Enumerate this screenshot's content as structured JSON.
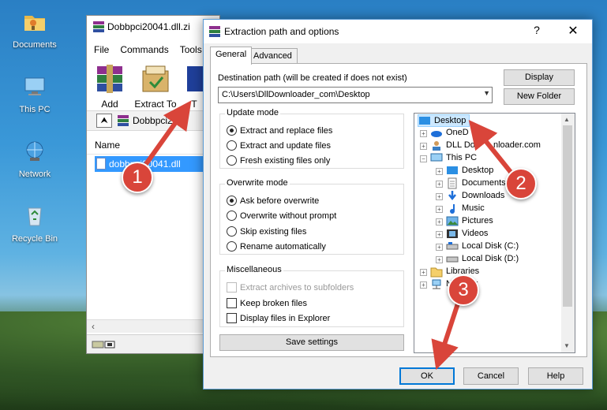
{
  "desktop": {
    "icons": [
      {
        "label": "Documents"
      },
      {
        "label": "This PC"
      },
      {
        "label": "Network"
      },
      {
        "label": "Recycle Bin"
      }
    ]
  },
  "winrar": {
    "title": "Dobbpci20041.dll.zi",
    "menu": [
      "File",
      "Commands",
      "Tools"
    ],
    "toolbar": {
      "add": "Add",
      "extract": "Extract To",
      "partial": "T"
    },
    "path": "Dobbpci20",
    "column_name": "Name",
    "selected_file": "dobbpci20041.dll"
  },
  "dialog": {
    "title": "Extraction path and options",
    "help": "?",
    "close": "✕",
    "tabs": [
      "General",
      "Advanced"
    ],
    "dest_label": "Destination path (will be created if does not exist)",
    "dest_value": "C:\\Users\\DllDownloader_com\\Desktop",
    "display_btn": "Display",
    "newfolder_btn": "New Folder",
    "update_mode": {
      "title": "Update mode",
      "options": [
        "Extract and replace files",
        "Extract and update files",
        "Fresh existing files only"
      ],
      "selected": 0
    },
    "overwrite_mode": {
      "title": "Overwrite mode",
      "options": [
        "Ask before overwrite",
        "Overwrite without prompt",
        "Skip existing files",
        "Rename automatically"
      ],
      "selected": 0
    },
    "misc": {
      "title": "Miscellaneous",
      "options": [
        "Extract archives to subfolders",
        "Keep broken files",
        "Display files in Explorer"
      ]
    },
    "save_btn": "Save settings",
    "tree": [
      {
        "label": "Desktop"
      },
      {
        "label": "OneD"
      },
      {
        "label": "DLL Do"
      },
      {
        "label": "nloader.com"
      },
      {
        "label": "This PC"
      },
      {
        "label": "Desktop"
      },
      {
        "label": "Documents"
      },
      {
        "label": "Downloads"
      },
      {
        "label": "Music"
      },
      {
        "label": "Pictures"
      },
      {
        "label": "Videos"
      },
      {
        "label": "Local Disk (C:)"
      },
      {
        "label": "Local Disk (D:)"
      },
      {
        "label": "Libraries"
      },
      {
        "label": "N"
      },
      {
        "label": "k"
      }
    ],
    "ok_btn": "OK",
    "cancel_btn": "Cancel",
    "help_btn": "Help"
  },
  "annotations": {
    "step1": "1",
    "step2": "2",
    "step3": "3"
  },
  "colors": {
    "accent": "#0078d7",
    "marker": "#d9453a",
    "selection": "#3399ff"
  }
}
